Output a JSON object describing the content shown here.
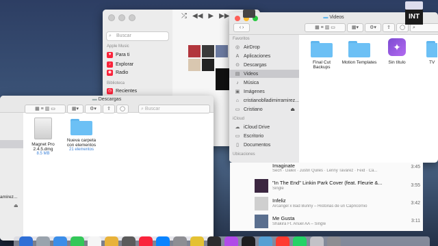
{
  "music_app": {
    "search_placeholder": "Buscar",
    "section_apple_music": "Apple Music",
    "items": [
      {
        "label": "Para ti",
        "icon": "heart-icon"
      },
      {
        "label": "Explorar",
        "icon": "music-note-icon"
      },
      {
        "label": "Radio",
        "icon": "radio-icon"
      }
    ],
    "section_library": "Biblioteca",
    "library_items": [
      {
        "label": "Recientes",
        "icon": "clock-icon"
      }
    ]
  },
  "finder_videos": {
    "title": "Videos",
    "favorites_header": "Favoritos",
    "favorites": [
      {
        "label": "AirDrop",
        "icon": "airdrop-icon"
      },
      {
        "label": "Aplicaciones",
        "icon": "applications-icon"
      },
      {
        "label": "Descargas",
        "icon": "downloads-icon"
      },
      {
        "label": "Videos",
        "icon": "videos-icon"
      },
      {
        "label": "Música",
        "icon": "music-icon"
      },
      {
        "label": "Imágenes",
        "icon": "images-icon"
      },
      {
        "label": "cristianoblladimirramirez...",
        "icon": "home-icon"
      },
      {
        "label": "Cristiano",
        "icon": "disk-icon"
      }
    ],
    "icloud_header": "iCloud",
    "icloud": [
      {
        "label": "iCloud Drive",
        "icon": "cloud-icon"
      },
      {
        "label": "Escritorio",
        "icon": "desktop-icon"
      },
      {
        "label": "Documentos",
        "icon": "documents-icon"
      }
    ],
    "locations_header": "Ubicaciones",
    "files": [
      {
        "name": "Final Cut Backups",
        "kind": "folder"
      },
      {
        "name": "Motion Templates",
        "kind": "folder"
      },
      {
        "name": "Sin título",
        "kind": "shortcut"
      },
      {
        "name": "TV",
        "kind": "folder"
      }
    ]
  },
  "finder_descargas": {
    "title": "Descargas",
    "search_placeholder": "Buscar",
    "files": [
      {
        "name": "Magnet Pro 2.4.5.dmg",
        "meta": "8.5 MB",
        "kind": "dmg"
      },
      {
        "name": "Nueva carpeta con elementos",
        "meta": "21 elementos",
        "kind": "folder"
      }
    ],
    "side_text": "amírez..."
  },
  "songs": [
    {
      "title": "Imaginate",
      "artist": "Sech · Dalex · Justin Quiles · Lenny Tavárez · Feid · Ca...",
      "duration": "3:45"
    },
    {
      "title": "\"In The End\" Linkin Park Cover (feat. Fleurie &...",
      "artist": "Single",
      "duration": "3:55"
    },
    {
      "title": "Infeliz",
      "artist": "Arcangel x Bad Bunny – Historias de un Capricornio",
      "duration": "3:42"
    },
    {
      "title": "Me Gusta",
      "artist": "Shakira Ft. Anuel AA – Single",
      "duration": "3:11"
    }
  ],
  "colors": {
    "accent": "#6cc0f5",
    "music_red": "#fa233b"
  }
}
